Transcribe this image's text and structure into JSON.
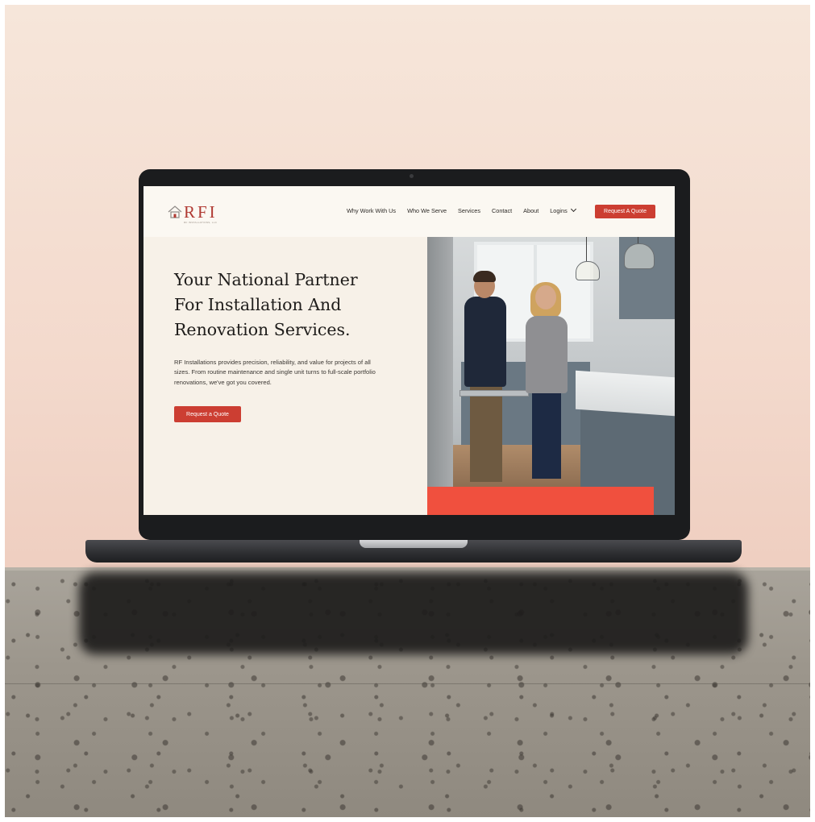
{
  "logo": {
    "text": "RFI",
    "subtext": "RF INSTALLATIONS, LLC"
  },
  "nav": {
    "links": [
      "Why Work With Us",
      "Who We Serve",
      "Services",
      "Contact",
      "About"
    ],
    "logins_label": "Logins",
    "cta_label": "Request A Quote"
  },
  "hero": {
    "title_lines": [
      "Your National Partner",
      "For Installation And",
      "Renovation Services."
    ],
    "body": "RF Installations provides precision, reliability, and value for projects of all sizes. From routine maintenance and single unit turns to full-scale portfolio renovations, we've got you covered.",
    "cta_label": "Request a Quote"
  },
  "colors": {
    "accent": "#cc3e32",
    "accent_bar": "#f0503e",
    "background": "#f7f1e8"
  },
  "icons": [
    "house-logo-icon",
    "chevron-down-icon"
  ]
}
